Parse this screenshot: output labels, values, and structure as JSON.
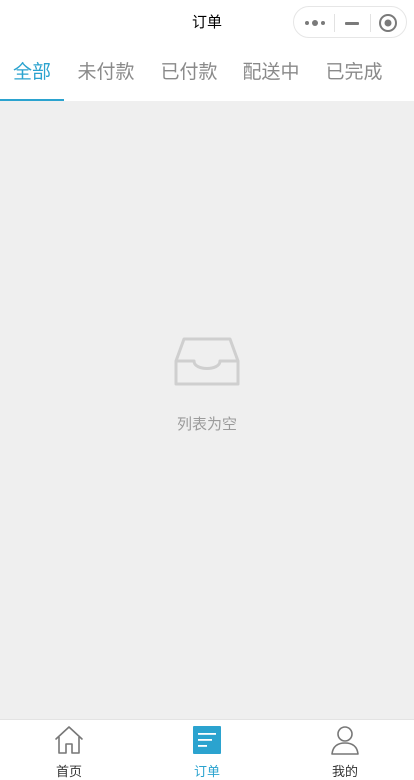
{
  "navbar": {
    "title": "订单"
  },
  "tabs": [
    {
      "label": "全部",
      "active": true
    },
    {
      "label": "未付款",
      "active": false
    },
    {
      "label": "已付款",
      "active": false
    },
    {
      "label": "配送中",
      "active": false
    },
    {
      "label": "已完成",
      "active": false
    }
  ],
  "empty_state": {
    "icon": "inbox-icon",
    "text": "列表为空"
  },
  "tabbar": {
    "items": [
      {
        "label": "首页",
        "icon": "home-icon",
        "active": false
      },
      {
        "label": "订单",
        "icon": "order-list-icon",
        "active": true
      },
      {
        "label": "我的",
        "icon": "user-icon",
        "active": false
      }
    ]
  },
  "colors": {
    "accent": "#2ba3cf",
    "tab_inactive": "#8a8a8a",
    "content_bg": "#efefef",
    "empty_text": "#9b9b9b"
  }
}
